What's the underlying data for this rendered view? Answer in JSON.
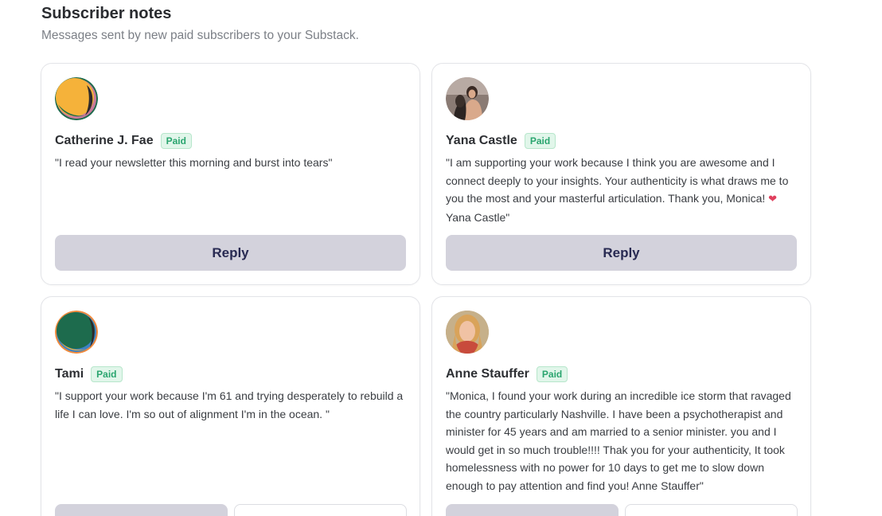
{
  "header": {
    "title": "Subscriber notes",
    "subtitle": "Messages sent by new paid subscribers to your Substack."
  },
  "cards": [
    {
      "name": "Catherine J. Fae",
      "badge": "Paid",
      "note": "\"I read your newsletter this morning and burst into tears\"",
      "reply_label": "Reply",
      "avatar": "abstract-orange-avatar"
    },
    {
      "name": "Yana Castle",
      "badge": "Paid",
      "note": "\"I am supporting your work because I think you are awesome and I connect deeply to your insights. Your authenticity is what draws me to you the most and your masterful articulation. Thank you, Monica!",
      "note_end": "Yana Castle\"",
      "reply_label": "Reply",
      "avatar": "photo-avatar"
    },
    {
      "name": "Tami",
      "badge": "Paid",
      "note": "\"I support your work because I'm 61 and trying desperately to rebuild a life I can love. I'm so out of alignment I'm in the ocean. \"",
      "avatar": "abstract-green-avatar"
    },
    {
      "name": "Anne Stauffer",
      "badge": "Paid",
      "note": "\"Monica, I found your work during an incredible ice storm that ravaged the country particularly Nashville. I have been a psychotherapist and minister for 45 years and am married to a senior minister. you and I would get in so much trouble!!!! Thak you for your authenticity, It took homelessness with no power for 10 days to get me to slow down enough to pay attention and find you! Anne Stauffer\"",
      "avatar": "photo-avatar"
    }
  ],
  "colors": {
    "badge_text": "#2aa56f",
    "badge_bg": "#e1f6ea",
    "reply_bg": "#d3d2dc",
    "reply_text": "#282a52",
    "heart": "#e0405e"
  },
  "icons": {
    "heart": "sparkling-heart-icon"
  }
}
